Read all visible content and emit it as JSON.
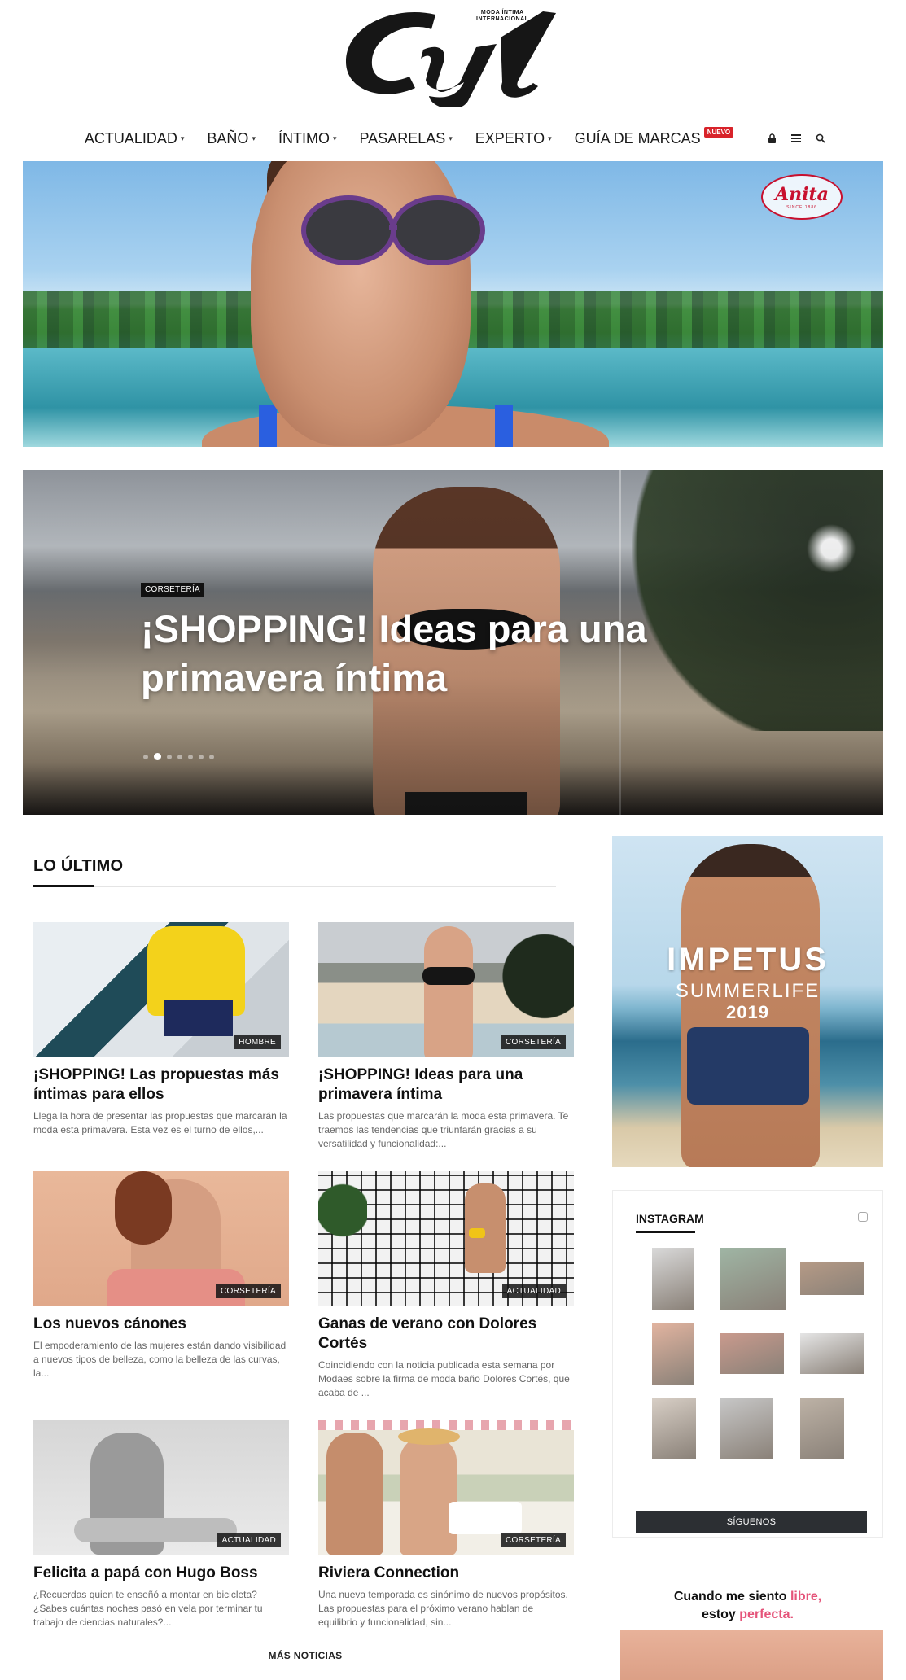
{
  "logo": {
    "text": "Cyl",
    "tagline_1": "MODA ÍNTIMA",
    "tagline_2": "INTERNACIONAL"
  },
  "nav": {
    "items": [
      {
        "label": "ACTUALIDAD",
        "caret": "▾"
      },
      {
        "label": "BAÑO",
        "caret": "▾"
      },
      {
        "label": "ÍNTIMO",
        "caret": "▾"
      },
      {
        "label": "PASARELAS",
        "caret": "▾"
      },
      {
        "label": "EXPERTO",
        "caret": "▾"
      },
      {
        "label": "GUÍA DE MARCAS",
        "badge": "NUEVO"
      }
    ],
    "icons": [
      "lock-icon",
      "menu-icon",
      "search-icon"
    ],
    "badge_color": "#d8232a"
  },
  "banner": {
    "brand": "Anita",
    "since": "SINCE 1886",
    "brand_color": "#c8102e"
  },
  "hero": {
    "category": "CORSETERÍA",
    "title": "¡SHOPPING! Ideas para una primavera íntima",
    "slide_count": 7,
    "active_slide": 2
  },
  "latest": {
    "section_title": "LO ÚLTIMO",
    "posts": [
      {
        "category": "HOMBRE",
        "title": "¡SHOPPING! Las propuestas más íntimas para ellos",
        "excerpt": "Llega la hora de presentar las propuestas que marcarán la moda esta primavera. Esta vez es el turno de ellos,..."
      },
      {
        "category": "CORSETERÍA",
        "title": "¡SHOPPING! Ideas para una primavera íntima",
        "excerpt": "Las propuestas que marcarán la moda esta primavera. Te traemos las tendencias que triunfarán gracias a su versatilidad y funcionalidad:..."
      },
      {
        "category": "CORSETERÍA",
        "title": "Los nuevos cánones",
        "excerpt": "El empoderamiento de las mujeres están dando visibilidad a nuevos tipos de belleza, como la belleza de las curvas, la..."
      },
      {
        "category": "ACTUALIDAD",
        "title": "Ganas de verano con Dolores Cortés",
        "excerpt": "Coincidiendo con la noticia publicada esta semana por Modaes sobre la firma de moda baño Dolores Cortés, que acaba de ..."
      },
      {
        "category": "ACTUALIDAD",
        "title": "Felicita a papá con Hugo Boss",
        "excerpt": "¿Recuerdas quien te enseñó a montar en bicicleta? ¿Sabes cuántas noches pasó en vela por terminar tu trabajo de ciencias naturales?..."
      },
      {
        "category": "CORSETERÍA",
        "title": "Riviera Connection",
        "excerpt": "Una nueva temporada es sinónimo de nuevos propósitos. Las propuestas para el próximo verano hablan de equilibrio y funcionalidad, sin..."
      }
    ],
    "more_label": "MÁS NOTICIAS"
  },
  "sidebar": {
    "ad": {
      "line1": "IMPETUS",
      "line2": "SUMMERLIFE",
      "line3": "2019"
    },
    "instagram": {
      "title": "INSTAGRAM",
      "follow_label": "SÍGUENOS",
      "tiles": [
        {
          "color": "#d9d9d9"
        },
        {
          "color": "#9fb5a4"
        },
        {
          "color": "#b59a86"
        },
        {
          "color": "#e2b4a0"
        },
        {
          "color": "#c99a8d"
        },
        {
          "color": "#e5e5e5"
        },
        {
          "color": "#d8cfc6"
        },
        {
          "color": "#c7c7c7"
        },
        {
          "color": "#bdb2a6"
        }
      ]
    },
    "promo": {
      "line1_a": "Cuando me siento ",
      "line1_b": "libre,",
      "line2_a": "estoy ",
      "line2_b": "perfecta.",
      "accent_color": "#e5547a"
    }
  }
}
